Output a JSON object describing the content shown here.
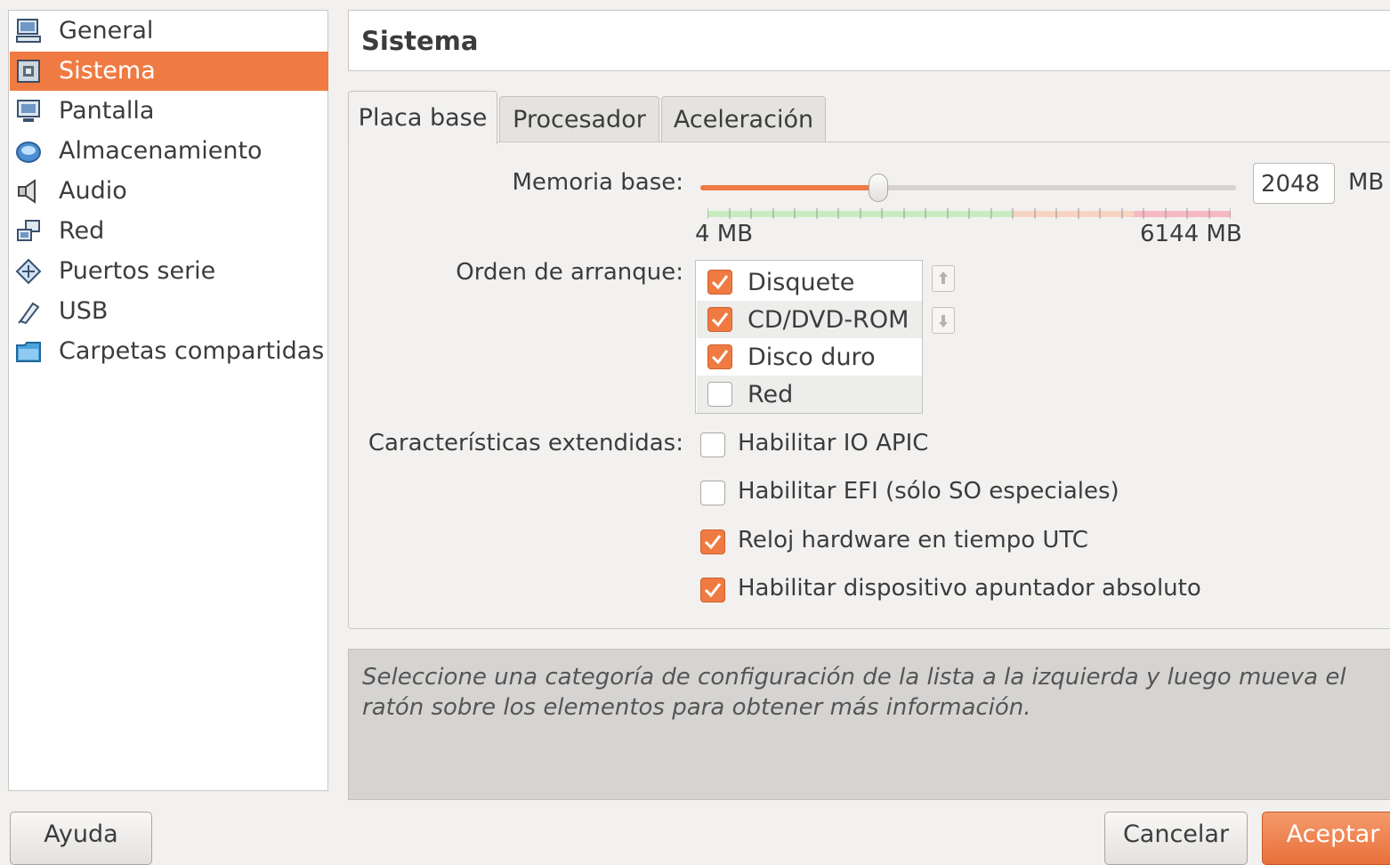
{
  "sidebar": {
    "items": [
      {
        "label": "General",
        "icon": "computer-icon",
        "selected": false
      },
      {
        "label": "Sistema",
        "icon": "motherboard-icon",
        "selected": true
      },
      {
        "label": "Pantalla",
        "icon": "monitor-icon",
        "selected": false
      },
      {
        "label": "Almacenamiento",
        "icon": "disk-icon",
        "selected": false
      },
      {
        "label": "Audio",
        "icon": "speaker-icon",
        "selected": false
      },
      {
        "label": "Red",
        "icon": "network-icon",
        "selected": false
      },
      {
        "label": "Puertos serie",
        "icon": "serial-port-icon",
        "selected": false
      },
      {
        "label": "USB",
        "icon": "usb-icon",
        "selected": false
      },
      {
        "label": "Carpetas compartidas",
        "icon": "folder-icon",
        "selected": false
      }
    ]
  },
  "header": {
    "title": "Sistema"
  },
  "tabs": [
    {
      "label": "Placa base",
      "active": true
    },
    {
      "label": "Procesador",
      "active": false
    },
    {
      "label": "Aceleración",
      "active": false
    }
  ],
  "memory": {
    "label": "Memoria base:",
    "value": "2048",
    "unit": "MB",
    "min_label": "4 MB",
    "max_label": "6144 MB",
    "min": 4,
    "max": 6144,
    "current": 2048
  },
  "boot": {
    "label": "Orden de arranque:",
    "items": [
      {
        "label": "Disquete",
        "checked": true
      },
      {
        "label": "CD/DVD-ROM",
        "checked": true
      },
      {
        "label": "Disco duro",
        "checked": true
      },
      {
        "label": "Red",
        "checked": false
      }
    ]
  },
  "extended": {
    "label": "Características extendidas:",
    "options": [
      {
        "label": "Habilitar IO APIC",
        "checked": false
      },
      {
        "label": "Habilitar EFI (sólo SO especiales)",
        "checked": false
      },
      {
        "label": "Reloj hardware en tiempo UTC",
        "checked": true
      },
      {
        "label": "Habilitar dispositivo apuntador absoluto",
        "checked": true
      }
    ]
  },
  "info": {
    "text": "Seleccione una categoría de configuración de la lista a la izquierda y luego mueva el ratón sobre los elementos para obtener más información."
  },
  "buttons": {
    "help": "Ayuda",
    "cancel": "Cancelar",
    "ok": "Aceptar"
  },
  "colors": {
    "accent": "#ef7b43",
    "slider_green": "#c8ecc0",
    "slider_orange": "#f7d3c2",
    "slider_red": "#f6b8c2"
  }
}
